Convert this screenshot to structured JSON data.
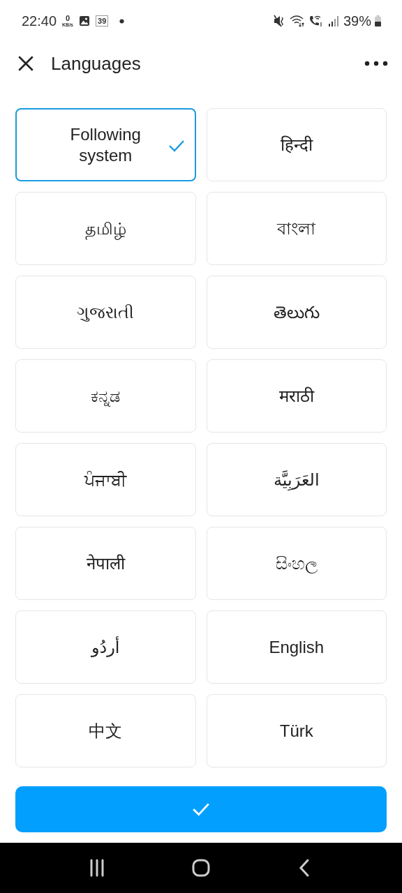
{
  "status_bar": {
    "time": "22:40",
    "speed_value": "0",
    "speed_unit": "KB/s",
    "badge": "39",
    "battery": "39%"
  },
  "header": {
    "title": "Languages"
  },
  "languages": [
    {
      "label": "Following system",
      "selected": true
    },
    {
      "label": "हिन्दी",
      "selected": false
    },
    {
      "label": "தமிழ்",
      "selected": false
    },
    {
      "label": "বাংলা",
      "selected": false
    },
    {
      "label": "ગુજરાતી",
      "selected": false
    },
    {
      "label": "తెలుగు",
      "selected": false
    },
    {
      "label": "ಕನ್ನಡ",
      "selected": false
    },
    {
      "label": "मराठी",
      "selected": false
    },
    {
      "label": "ਪੰਜਾਬੀ",
      "selected": false
    },
    {
      "label": "العَرَبِيَّة",
      "selected": false
    },
    {
      "label": "नेपाली",
      "selected": false
    },
    {
      "label": "සිංහල",
      "selected": false
    },
    {
      "label": "أردُو",
      "selected": false
    },
    {
      "label": "English",
      "selected": false
    },
    {
      "label": "中文",
      "selected": false
    },
    {
      "label": "Türk",
      "selected": false
    }
  ]
}
